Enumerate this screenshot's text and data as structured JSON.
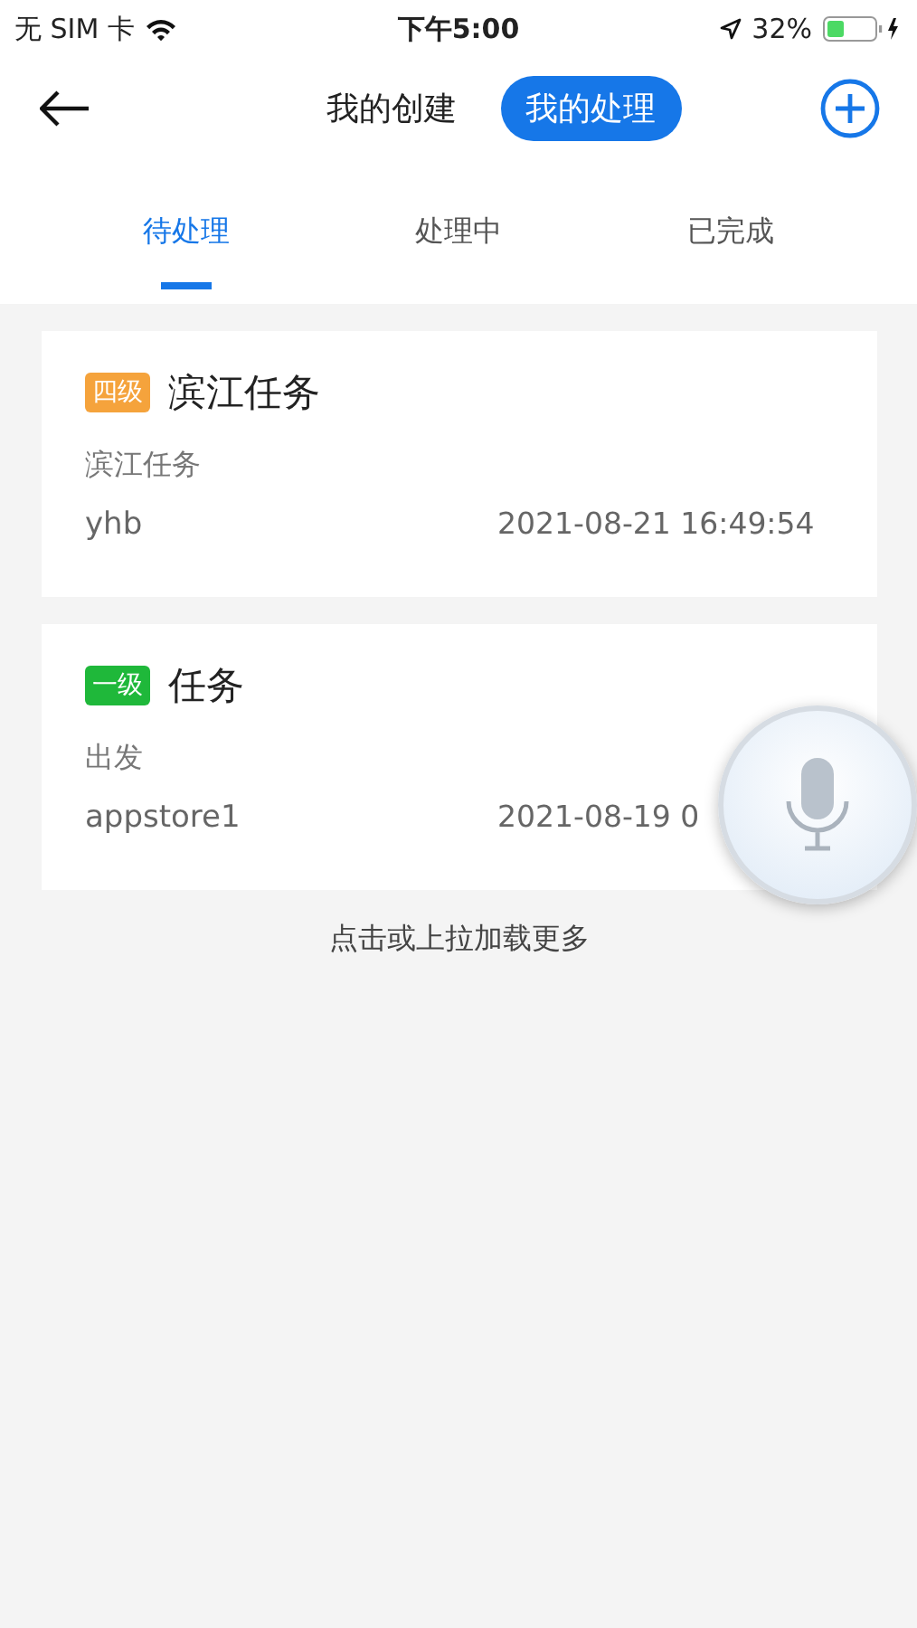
{
  "status_bar": {
    "carrier": "无 SIM 卡",
    "time": "下午5:00",
    "battery": "32%"
  },
  "segments": [
    {
      "label": "我的创建",
      "selected": false
    },
    {
      "label": "我的处理",
      "selected": true
    }
  ],
  "tabs": [
    {
      "label": "待处理",
      "selected": true
    },
    {
      "label": "处理中",
      "selected": false
    },
    {
      "label": "已完成",
      "selected": false
    }
  ],
  "tasks": [
    {
      "level": "四级",
      "color": "#f5a33c",
      "title": "滨江任务",
      "description": "滨江任务",
      "user": "yhb",
      "time": "2021-08-21 16:49:54"
    },
    {
      "level": "一级",
      "color": "#1fb83a",
      "title": "任务",
      "description": "出发",
      "user": "appstore1",
      "time": "2021-08-19 0"
    }
  ],
  "load_more": "点击或上拉加载更多"
}
